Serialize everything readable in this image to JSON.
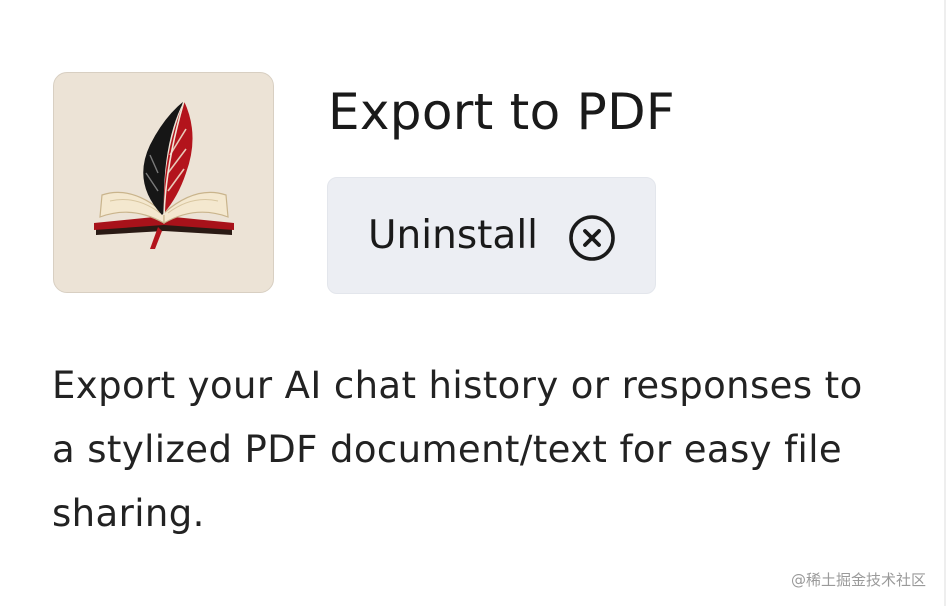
{
  "plugin": {
    "title": "Export to PDF",
    "logo_icon": "quill-and-open-book-icon",
    "uninstall_label": "Uninstall",
    "uninstall_icon": "close-circle-icon",
    "description": "Export your AI chat history or responses to a stylized PDF document/text for easy file sharing."
  },
  "watermark": "@稀土掘金技术社区",
  "colors": {
    "logo_background": "#ece3d6",
    "button_background": "#eceef3",
    "quill_red": "#b3141c",
    "quill_dark": "#161616"
  }
}
